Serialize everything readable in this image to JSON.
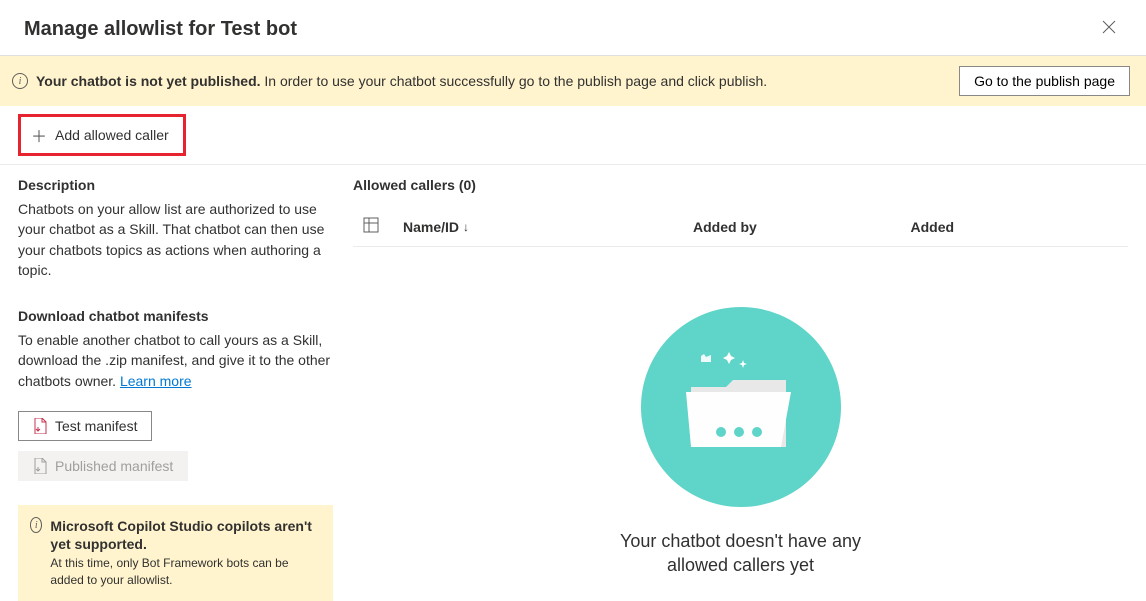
{
  "header": {
    "title": "Manage allowlist for Test bot"
  },
  "banner": {
    "bold": "Your chatbot is not yet published.",
    "text": " In order to use your chatbot successfully go to the publish page and click publish.",
    "button": "Go to the publish page"
  },
  "toolbar": {
    "add_caller": "Add allowed caller"
  },
  "left": {
    "description_title": "Description",
    "description_text": "Chatbots on your allow list are authorized to use your chatbot as a Skill. That chatbot can then use your chatbots topics as actions when authoring a topic.",
    "download_title": "Download chatbot manifests",
    "download_text": "To enable another chatbot to call yours as a Skill, download the .zip manifest, and give it to the other chatbots owner. ",
    "learn_more": "Learn more",
    "test_manifest": "Test manifest",
    "published_manifest": "Published manifest",
    "note_bold": "Microsoft Copilot Studio copilots aren't yet supported.",
    "note_text": "At this time, only Bot Framework bots can be added to your allowlist."
  },
  "right": {
    "callers_title": "Allowed callers (0)",
    "col_name": "Name/ID",
    "col_addedby": "Added by",
    "col_added": "Added",
    "empty_text": "Your chatbot doesn't have any allowed callers yet"
  }
}
